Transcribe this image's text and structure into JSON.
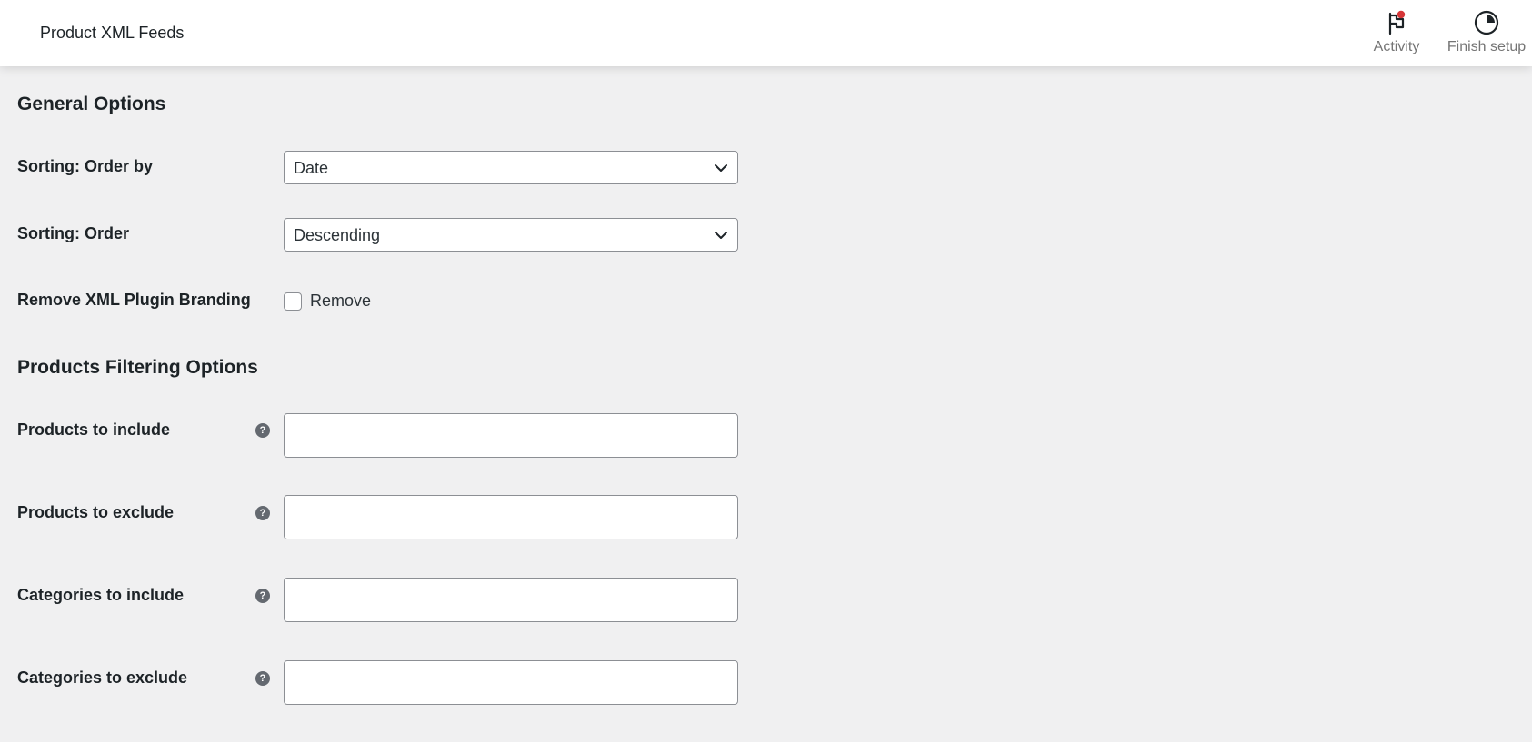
{
  "header": {
    "title": "Product XML Feeds",
    "actions": [
      {
        "label": "Activity",
        "icon": "flag-icon",
        "has_notification": true,
        "notification_color": "#d63638"
      },
      {
        "label": "Finish setup",
        "icon": "progress-pie-icon"
      }
    ]
  },
  "general": {
    "heading": "General Options",
    "order_by": {
      "label": "Sorting: Order by",
      "value": "Date"
    },
    "order": {
      "label": "Sorting: Order",
      "value": "Descending"
    },
    "branding": {
      "label": "Remove XML Plugin Branding",
      "checkbox_label": "Remove",
      "checked": false
    }
  },
  "filtering": {
    "heading": "Products Filtering Options",
    "fields": [
      {
        "label": "Products to include",
        "value": "",
        "help_icon": "question-icon"
      },
      {
        "label": "Products to exclude",
        "value": "",
        "help_icon": "question-icon"
      },
      {
        "label": "Categories to include",
        "value": "",
        "help_icon": "question-icon"
      },
      {
        "label": "Categories to exclude",
        "value": "",
        "help_icon": "question-icon"
      }
    ]
  },
  "colors": {
    "background": "#f0f0f1",
    "topbar": "#ffffff",
    "text": "#1d2327",
    "muted": "#757575",
    "border": "#8c8f94",
    "notification": "#d63638"
  }
}
